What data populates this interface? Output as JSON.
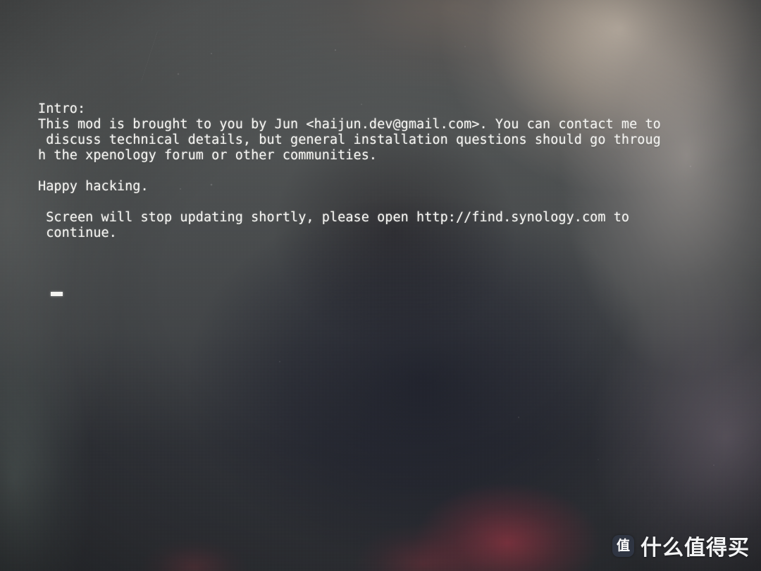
{
  "screen": {
    "kind": "photographed-monitor-boot-console",
    "background_base_color": "#525555",
    "text_color": "#f2f2ef",
    "dark_shadow_color": "#1a1c26",
    "warm_glare_color": "#e8d8c6",
    "red_glow_color": "#c43c4e",
    "cursor_label": "block-cursor"
  },
  "console": {
    "lines": [
      "Intro:",
      "This mod is brought to you by Jun <haijun.dev@gmail.com>. You can contact me to",
      " discuss technical details, but general installation questions should go throug",
      "h the xpenology forum or other communities.",
      "",
      "Happy hacking.",
      "",
      " Screen will stop updating shortly, please open http://find.synology.com to",
      " continue."
    ],
    "author_name": "Jun",
    "author_email": "haijun.dev@gmail.com",
    "forum_name": "xpenology",
    "find_url": "http://find.synology.com",
    "cursor": "_"
  },
  "watermark": {
    "logo_glyph": "值",
    "text": "什么值得买",
    "logo_bg_color": "#2f3542",
    "text_color": "#f4f5f6"
  }
}
